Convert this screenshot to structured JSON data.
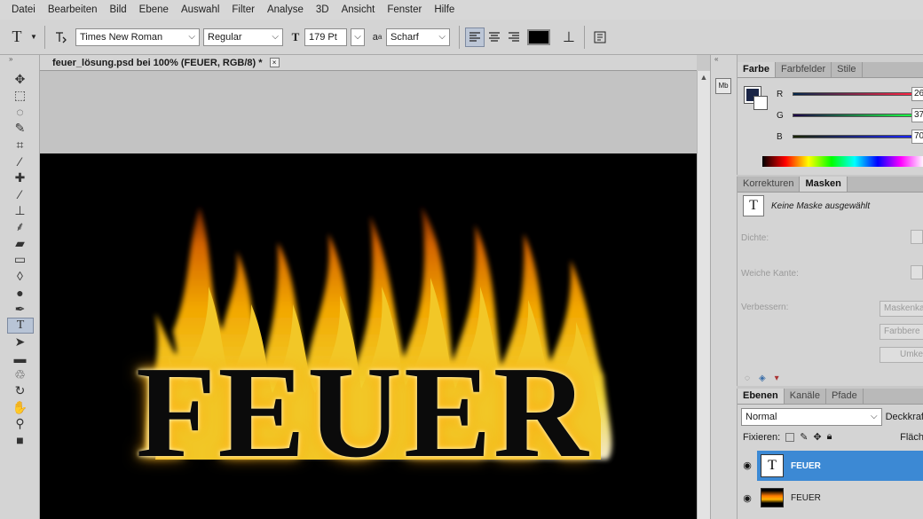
{
  "menubar": {
    "items": [
      "Datei",
      "Bearbeiten",
      "Bild",
      "Ebene",
      "Auswahl",
      "Filter",
      "Analyse",
      "3D",
      "Ansicht",
      "Fenster",
      "Hilfe"
    ]
  },
  "options": {
    "font_family": "Times New Roman",
    "font_style": "Regular",
    "font_size": "179 Pt",
    "antialias": "Scharf",
    "text_color": "#000000"
  },
  "document": {
    "tab_title": "feuer_lösung.psd bei 100% (FEUER, RGB/8) *",
    "canvas_text": "FEUER"
  },
  "color_panel": {
    "tabs": [
      "Farbe",
      "Farbfelder",
      "Stile"
    ],
    "r_label": "R",
    "r_value": "26",
    "g_label": "G",
    "g_value": "37",
    "b_label": "B",
    "b_value": "70",
    "foreground": "#1a2546"
  },
  "masks_panel": {
    "tabs": [
      "Korrekturen",
      "Masken"
    ],
    "status": "Keine Maske ausgewählt",
    "density_label": "Dichte:",
    "feather_label": "Weiche Kante:",
    "refine_label": "Verbessern:",
    "btn_edge": "Maskenka",
    "btn_color": "Farbbere",
    "btn_invert": "Umkeh"
  },
  "layers_panel": {
    "tabs": [
      "Ebenen",
      "Kanäle",
      "Pfade"
    ],
    "blend_mode": "Normal",
    "opacity_label": "Deckkraf",
    "lock_label": "Fixieren:",
    "fill_label": "Fläch",
    "layers": [
      {
        "name": "FEUER",
        "type": "text",
        "selected": true
      },
      {
        "name": "FEUER",
        "type": "image",
        "selected": false
      }
    ]
  },
  "mini_panel": {
    "label": "Mb"
  }
}
